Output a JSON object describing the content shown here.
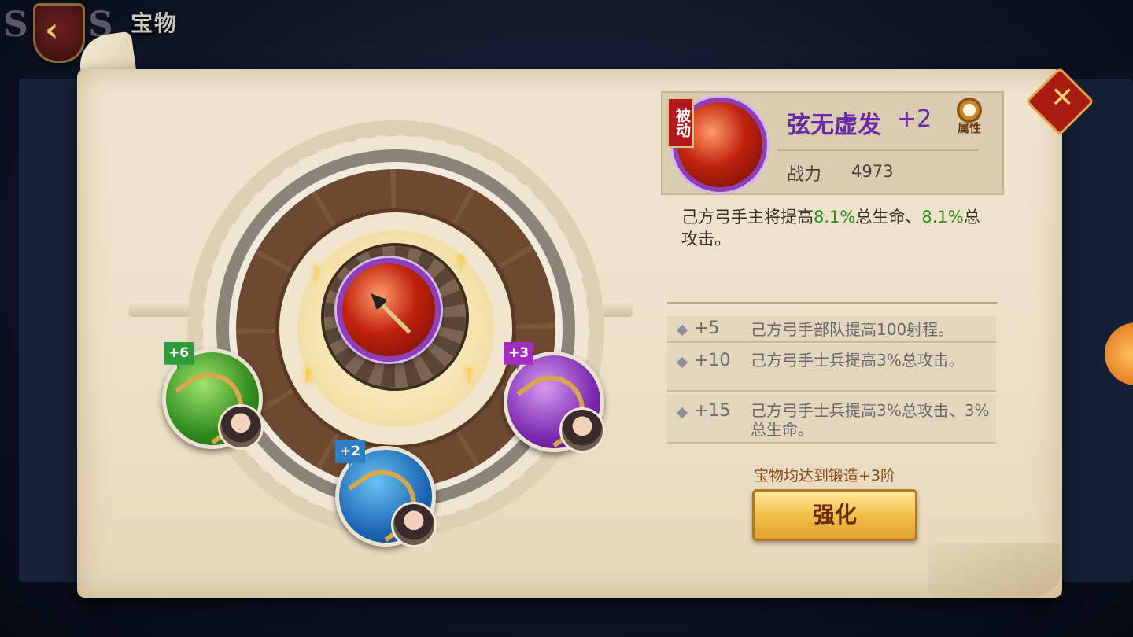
{
  "header": {
    "back_icon": "back-arrow-icon",
    "title": "宝物"
  },
  "treasure": {
    "badge": "被动",
    "name": "弦无虚发",
    "plus": "+2",
    "power_label": "战力",
    "power_value": "4973",
    "attr_button_label": "属性",
    "description_parts": [
      "己方弓手主将提高",
      "8.1%",
      "总生命、",
      "8.1%",
      "总攻击。"
    ]
  },
  "wheel": {
    "tags": {
      "green": "+6",
      "blue": "+2",
      "purple": "+3"
    }
  },
  "bonuses": [
    {
      "level": "+5",
      "text": "己方弓手部队提高100射程。"
    },
    {
      "level": "+10",
      "text": "己方弓手士兵提高3%总攻击。"
    },
    {
      "level": "+15",
      "text": "己方弓手士兵提高3%总攻击、3%总生命。"
    }
  ],
  "requirement": "宝物均达到锻造+3阶",
  "enhance_button": "强化",
  "colors": {
    "highlight_green": "#2f8c1f",
    "name_purple": "#6b2aa8"
  }
}
